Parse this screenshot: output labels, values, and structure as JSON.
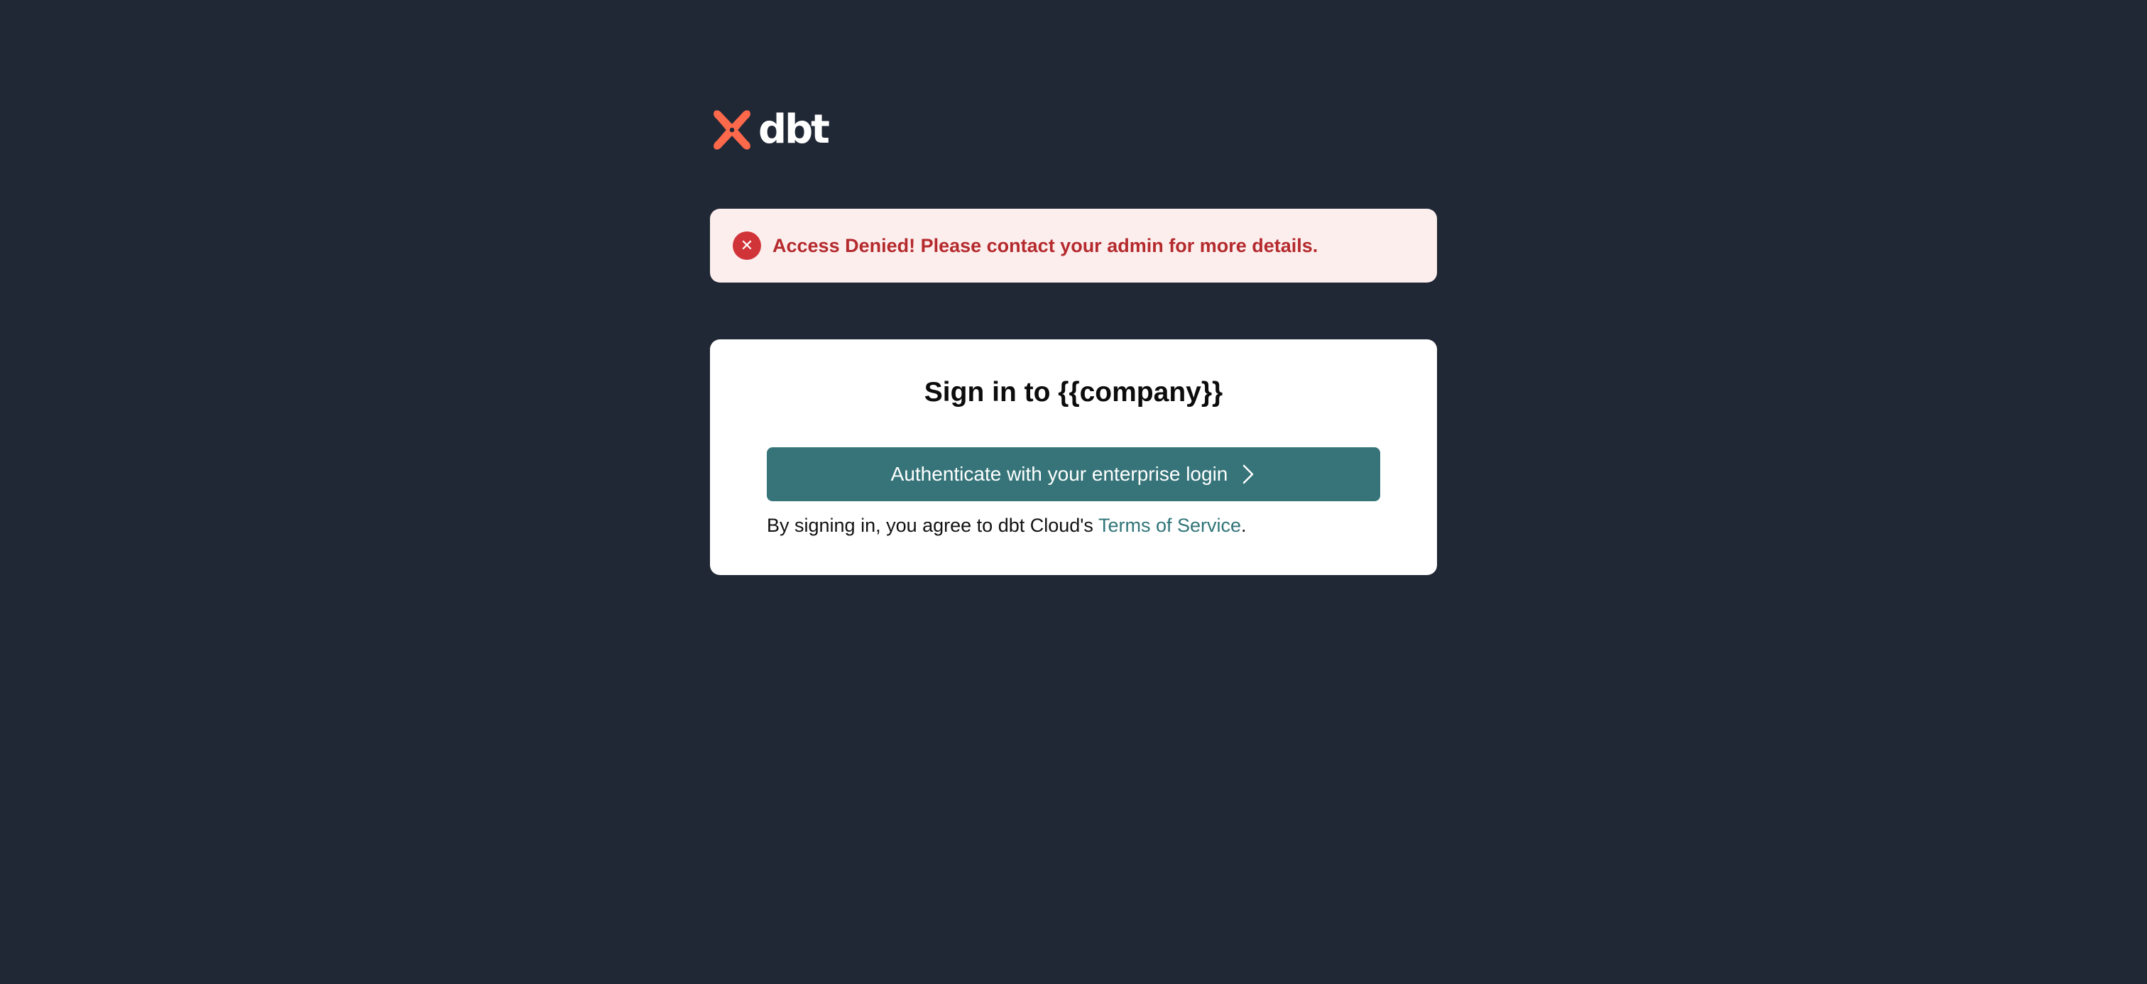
{
  "brand": {
    "name": "dbt",
    "logo_icon": "dbt-logo-icon",
    "accent_color": "#FF694B"
  },
  "alert": {
    "icon": "error-x-icon",
    "message": "Access Denied! Please contact your admin for more details.",
    "color": "#B42A2D",
    "background": "#FDEEEE"
  },
  "signin": {
    "title": "Sign in to {{company}}",
    "button_label": "Authenticate with your enterprise login",
    "button_icon": "chevron-right-icon",
    "button_color": "#367479",
    "terms_prefix": "By signing in, you agree to dbt Cloud's ",
    "terms_link": "Terms of Service",
    "terms_suffix": "."
  },
  "colors": {
    "page_background": "#212835",
    "card_background": "#FFFFFF",
    "link": "#2F7478"
  }
}
